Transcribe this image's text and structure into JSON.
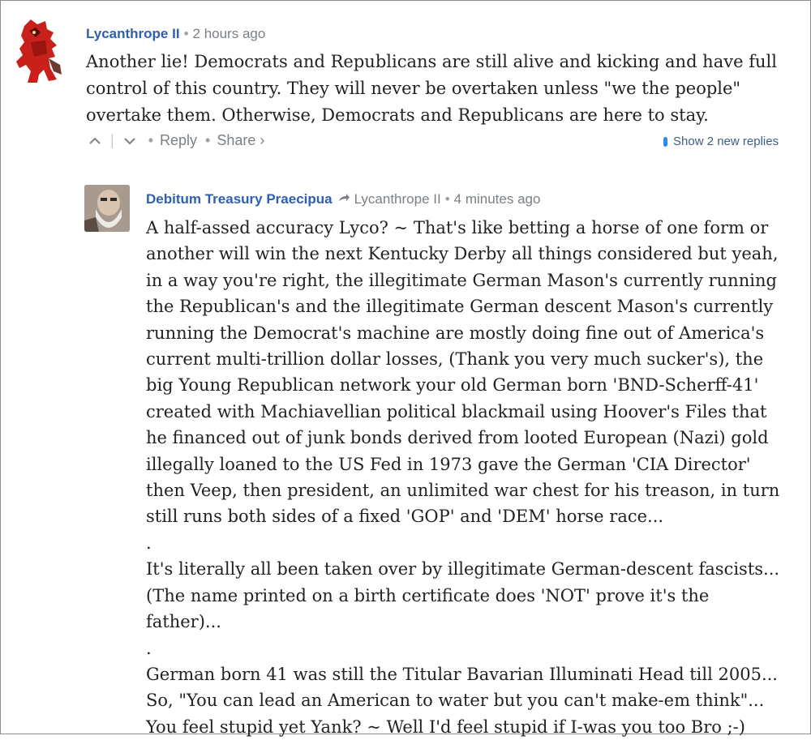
{
  "comment": {
    "author": "Lycanthrope II",
    "time": "2 hours ago",
    "text": "Another lie! Democrats and Republicans are still alive and kicking and have full control of this country. They will never be overtaken unless \"we the people\" overtake them. Otherwise, Democrats and Republicans are here to stay.",
    "actions": {
      "upvote": "^",
      "downvote": "v",
      "reply": "Reply",
      "share": "Share ›"
    },
    "show_replies": "Show 2 new replies"
  },
  "reply": {
    "author": "Debitum Treasury Praecipua",
    "replying_to": "Lycanthrope II",
    "time": "4 minutes ago",
    "paragraphs": [
      "A half-assed accuracy Lyco? ~ That's like betting a horse of one form or another will win the next Kentucky Derby all things considered but yeah, in a way you're right, the illegitimate German Mason's currently running the Republican's and the illegitimate German descent Mason's currently running the Democrat's machine are mostly doing fine out of America's current multi-trillion dollar losses, (Thank you very much sucker's), the big Young Republican network your old German born 'BND-Scherff-41' created with Machiavellian political blackmail using Hoover's Files that he financed out of junk bonds derived from looted European (Nazi) gold illegally loaned to the US Fed in 1973 gave the German 'CIA Director' then Veep, then president, an unlimited war chest for his treason, in turn still runs both sides of a fixed 'GOP' and 'DEM' horse race...",
      ".",
      "It's literally all been taken over by illegitimate German-descent fascists... (The name printed on a birth certificate does 'NOT' prove it's the father)...",
      ".",
      "German born 41 was still the Titular Bavarian Illuminati Head till 2005... So, \"You can lead an American to water but you can't make-em think\"... You feel stupid yet Yank? ~ Well I'd feel stupid if I-was you too Bro ;-)"
    ]
  },
  "colors": {
    "author_link": "#2e5fb0",
    "meta_gray": "#7a8085",
    "show_replies_blue": "#2f8de4"
  }
}
